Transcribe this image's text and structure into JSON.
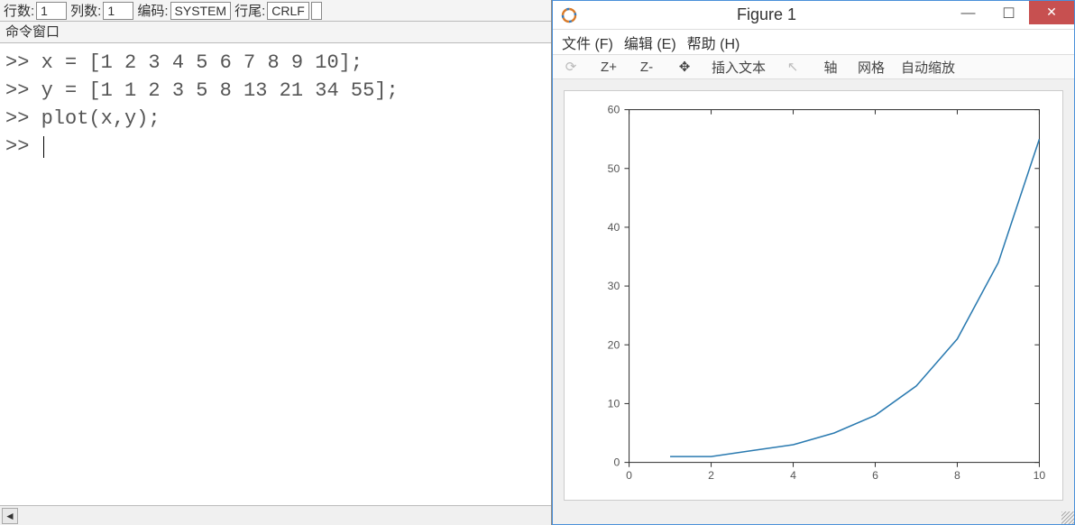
{
  "status": {
    "rows_label": "行数:",
    "rows_value": "1",
    "cols_label": "列数:",
    "cols_value": "1",
    "encoding_label": "编码:",
    "encoding_value": "SYSTEM",
    "eol_label": "行尾:",
    "eol_value": "CRLF"
  },
  "cmd_window_title": "命令窗口",
  "commands": {
    "line1": ">> x = [1 2 3 4 5 6 7 8 9 10];",
    "line2": ">> y = [1 1 2 3 5 8 13 21 34 55];",
    "line3": ">> plot(x,y);",
    "prompt": ">> "
  },
  "figure": {
    "title": "Figure 1",
    "menus": {
      "file": "文件 (F)",
      "edit": "编辑 (E)",
      "help": "帮助 (H)"
    },
    "toolbar": {
      "rotate": "⟳",
      "zoom_in": "Z+",
      "zoom_out": "Z-",
      "pan": "✥",
      "insert_text": "插入文本",
      "select": "↖",
      "axis": "轴",
      "grid": "网格",
      "autoscale": "自动缩放"
    }
  },
  "chart_data": {
    "type": "line",
    "x": [
      1,
      2,
      3,
      4,
      5,
      6,
      7,
      8,
      9,
      10
    ],
    "y": [
      1,
      1,
      2,
      3,
      5,
      8,
      13,
      21,
      34,
      55
    ],
    "xlim": [
      0,
      10
    ],
    "ylim": [
      0,
      60
    ],
    "xticks": [
      0,
      2,
      4,
      6,
      8,
      10
    ],
    "yticks": [
      0,
      10,
      20,
      30,
      40,
      50,
      60
    ],
    "title": "",
    "xlabel": "",
    "ylabel": ""
  }
}
